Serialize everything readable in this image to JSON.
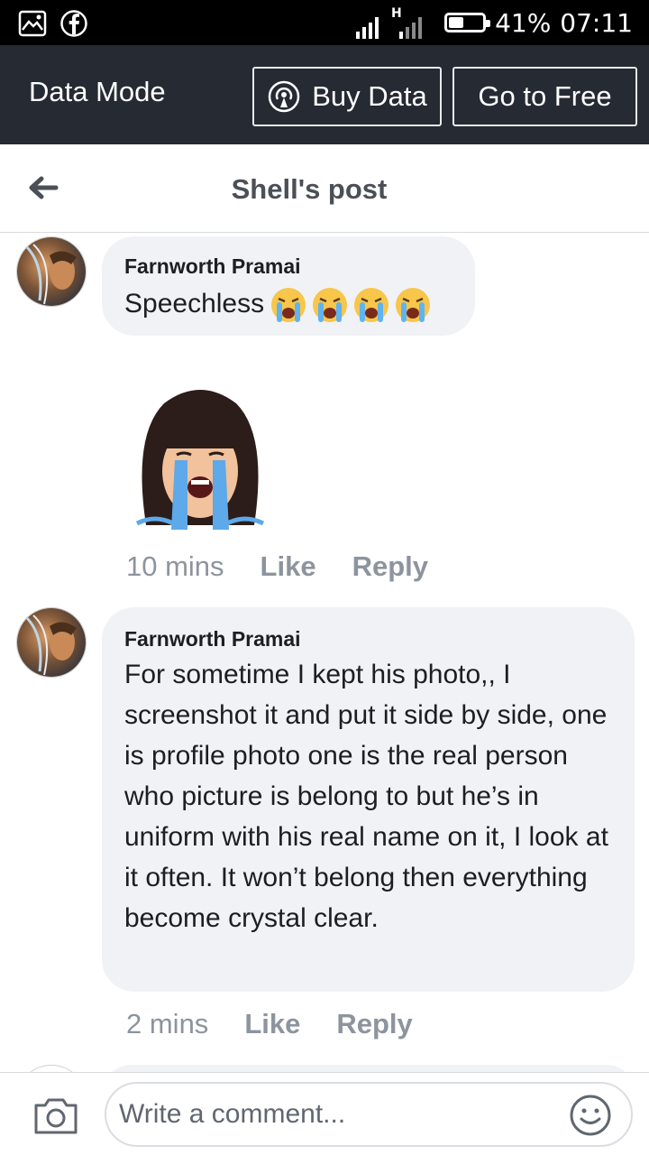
{
  "status_bar": {
    "battery_percent": 41,
    "battery_label": "41%",
    "time": "07:11",
    "network_label": "H",
    "icons": [
      "gallery-icon",
      "facebook-icon",
      "signal-icon",
      "battery-icon"
    ]
  },
  "data_bar": {
    "title": "Data Mode",
    "buy_label": "Buy Data",
    "free_label": "Go to Free"
  },
  "post_header": {
    "title": "Shell's post"
  },
  "comments": [
    {
      "author": "Farnworth Pramai",
      "text": "Speechless",
      "emoji": [
        "😭",
        "😭",
        "😭",
        "😭"
      ],
      "time": "10 mins",
      "like_label": "Like",
      "reply_label": "Reply"
    },
    {
      "author": "Farnworth Pramai",
      "text": "For sometime I kept his photo,, I screenshot it and put it side by side, one is profile photo one is the real person who picture is belong to but he’s in uniform with his real name on it, I look at it often. It won’t belong then everything become crystal clear.",
      "time": "2 mins",
      "like_label": "Like",
      "reply_label": "Reply"
    }
  ],
  "composer": {
    "placeholder": "Write a comment..."
  },
  "colors": {
    "status_bar": "#000000",
    "data_bar": "#252a33",
    "bubble": "#f0f2f5",
    "meta_text": "#8d949e",
    "title_text": "#4b4f56"
  }
}
